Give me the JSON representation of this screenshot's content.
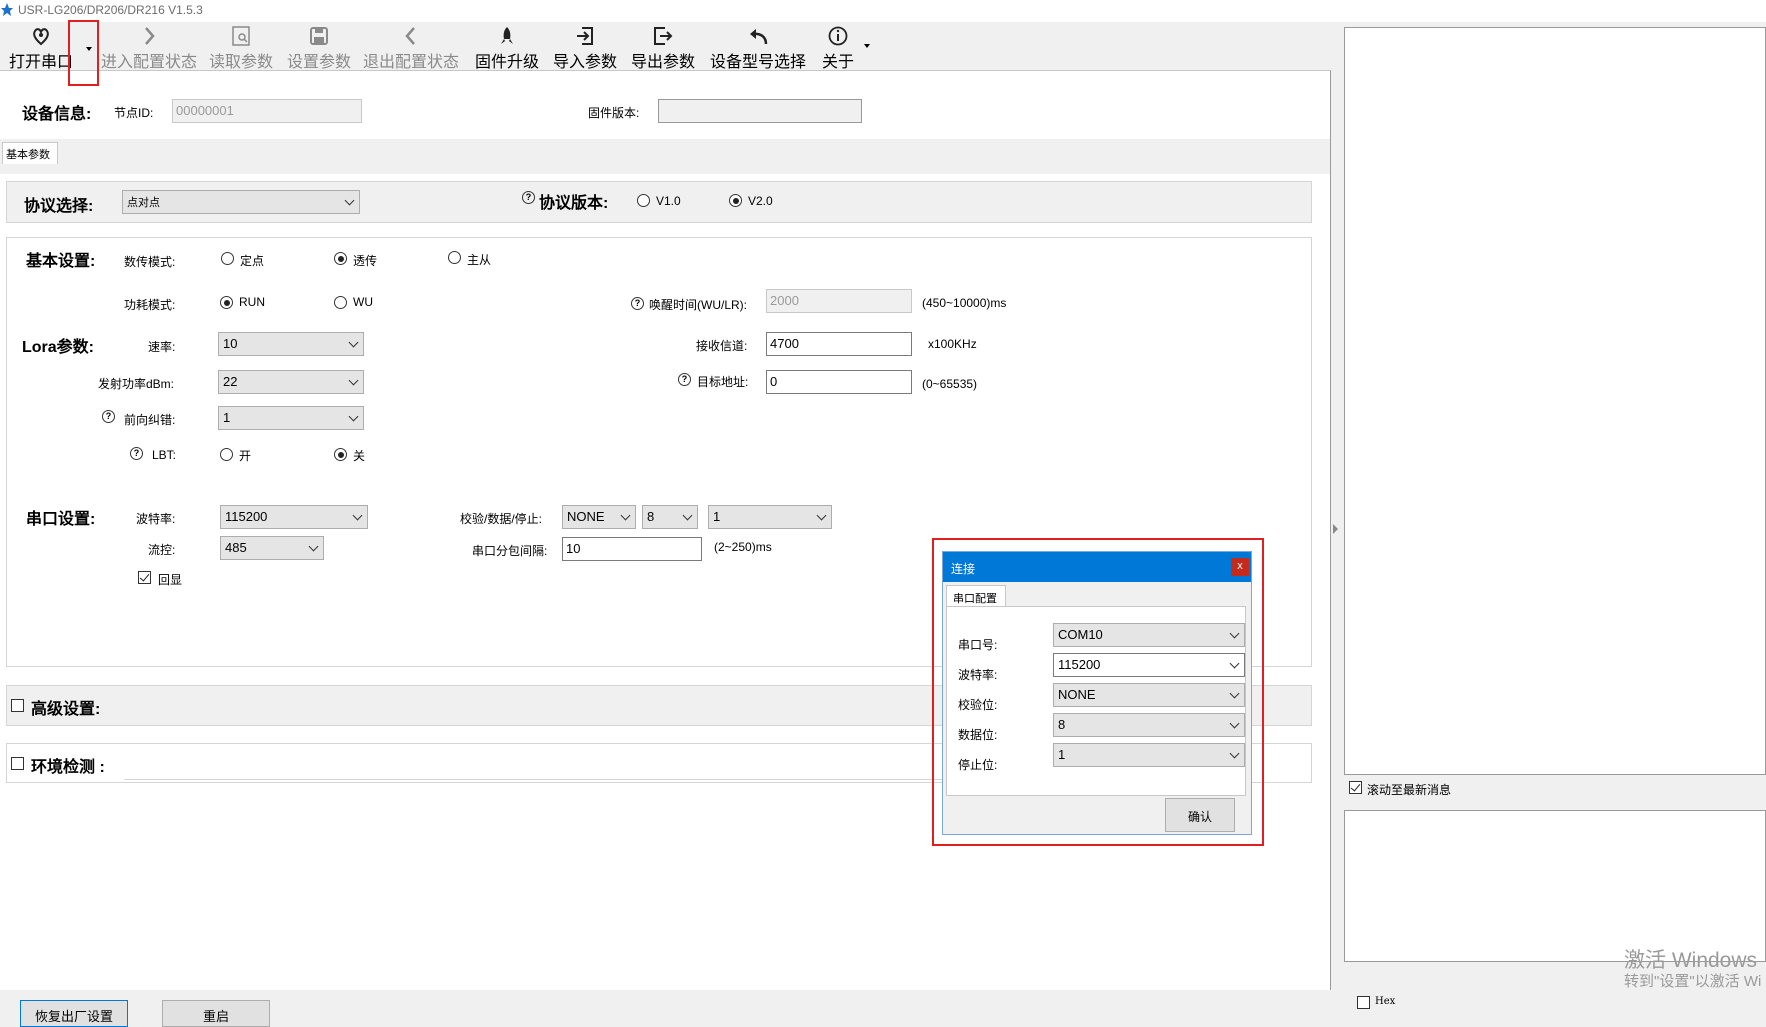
{
  "window": {
    "title": "USR-LG206/DR206/DR216 V1.5.3"
  },
  "toolbar": {
    "buttons": [
      {
        "label": "打开串口",
        "icon": "heart-pin-icon"
      },
      {
        "label": "进入配置状态",
        "icon": "chevron-right-icon"
      },
      {
        "label": "读取参数",
        "icon": "read-doc-icon"
      },
      {
        "label": "设置参数",
        "icon": "save-icon"
      },
      {
        "label": "退出配置状态",
        "icon": "chevron-left-icon"
      },
      {
        "label": "固件升级",
        "icon": "rocket-icon"
      },
      {
        "label": "导入参数",
        "icon": "import-icon"
      },
      {
        "label": "导出参数",
        "icon": "export-icon"
      },
      {
        "label": "设备型号选择",
        "icon": "undo-arrow-icon"
      },
      {
        "label": "关于",
        "icon": "info-icon"
      }
    ]
  },
  "device_info": {
    "heading": "设备信息:",
    "node_id_label": "节点ID:",
    "node_id_value": "00000001",
    "firmware_label": "固件版本:",
    "firmware_value": ""
  },
  "tab": {
    "basic": "基本参数"
  },
  "protocol": {
    "label": "协议选择:",
    "value": "点对点",
    "version_label": "协议版本:",
    "v1": "V1.0",
    "v2": "V2.0",
    "selected": "V2.0"
  },
  "basic": {
    "heading": "基本设置:",
    "mode_label": "数传模式:",
    "mode_options": [
      "定点",
      "透传",
      "主从"
    ],
    "mode_selected": "透传",
    "power_label": "功耗模式:",
    "power_options": [
      "RUN",
      "WU"
    ],
    "power_selected": "RUN",
    "wake_label": "唤醒时间(WU/LR):",
    "wake_value": "2000",
    "wake_range": "(450~10000)ms"
  },
  "lora": {
    "heading": "Lora参数:",
    "rate_label": "速率:",
    "rate_value": "10",
    "power_label": "发射功率dBm:",
    "power_value": "22",
    "fec_label": "前向纠错:",
    "fec_value": "1",
    "lbt_label": "LBT:",
    "lbt_on": "开",
    "lbt_off": "关",
    "lbt_selected": "关",
    "channel_label": "接收信道:",
    "channel_value": "4700",
    "channel_unit": "x100KHz",
    "target_label": "目标地址:",
    "target_value": "0",
    "target_range": "(0~65535)"
  },
  "serial": {
    "heading": "串口设置:",
    "baud_label": "波特率:",
    "baud_value": "115200",
    "flow_label": "流控:",
    "flow_value": "485",
    "echo_label": "回显",
    "echo_checked": true,
    "parity_label": "校验/数据/停止:",
    "parity_value": "NONE",
    "data_value": "8",
    "stop_value": "1",
    "interval_label": "串口分包间隔:",
    "interval_value": "10",
    "interval_range": "(2~250)ms"
  },
  "advanced": {
    "label": "高级设置:"
  },
  "env": {
    "label": "环境检测 :"
  },
  "right_panel": {
    "scroll_label": "滚动至最新消息",
    "scroll_checked": true,
    "hex_label": "Hex",
    "hex_checked": false
  },
  "bottom": {
    "restore_label": "恢复出厂设置",
    "restart_label": "重启"
  },
  "dialog": {
    "title": "连接",
    "close": "x",
    "tab": "串口配置",
    "fields": [
      {
        "label": "串口号:",
        "value": "COM10"
      },
      {
        "label": "波特率:",
        "value": "115200"
      },
      {
        "label": "校验位:",
        "value": "NONE"
      },
      {
        "label": "数据位:",
        "value": "8"
      },
      {
        "label": "停止位:",
        "value": "1"
      }
    ],
    "confirm": "确认"
  },
  "watermark": {
    "line1": "激活 Windows",
    "line2": "转到\"设置\"以激活 Wi"
  },
  "colors": {
    "accent": "#0078d7",
    "highlight": "#e02020"
  }
}
